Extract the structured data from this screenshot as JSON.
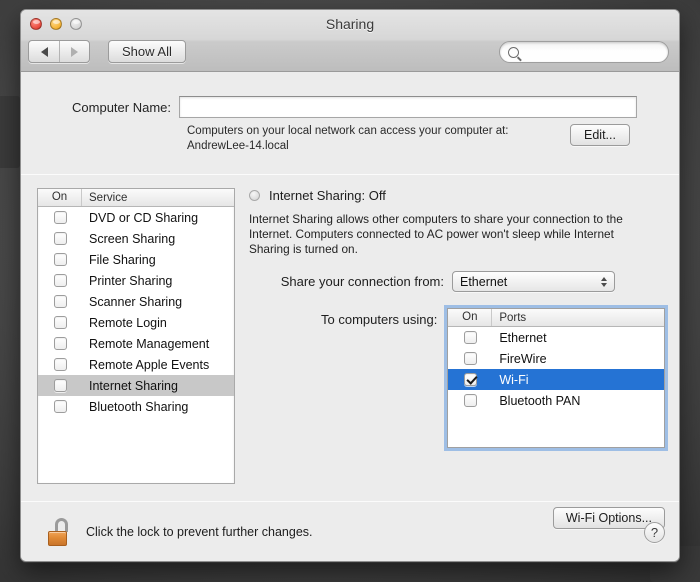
{
  "window": {
    "title": "Sharing",
    "traffic_lights": [
      "close-button",
      "minimize-button",
      "zoom-button"
    ]
  },
  "toolbar": {
    "back_label": "◀",
    "forward_label": "▶",
    "show_all_label": "Show All",
    "search_value": "",
    "search_placeholder": ""
  },
  "computer_name": {
    "label": "Computer Name:",
    "value": "",
    "placeholder": "",
    "help_line1": "Computers on your local network can access your computer at:",
    "help_line2": "AndrewLee-14.local",
    "edit_label": "Edit..."
  },
  "services_list": {
    "header_on": "On",
    "header_service": "Service",
    "rows": [
      {
        "label": "DVD or CD Sharing",
        "checked": false,
        "selected": false
      },
      {
        "label": "Screen Sharing",
        "checked": false,
        "selected": false
      },
      {
        "label": "File Sharing",
        "checked": false,
        "selected": false
      },
      {
        "label": "Printer Sharing",
        "checked": false,
        "selected": false
      },
      {
        "label": "Scanner Sharing",
        "checked": false,
        "selected": false
      },
      {
        "label": "Remote Login",
        "checked": false,
        "selected": false
      },
      {
        "label": "Remote Management",
        "checked": false,
        "selected": false
      },
      {
        "label": "Remote Apple Events",
        "checked": false,
        "selected": false
      },
      {
        "label": "Internet Sharing",
        "checked": false,
        "selected": true
      },
      {
        "label": "Bluetooth Sharing",
        "checked": false,
        "selected": false
      }
    ]
  },
  "detail": {
    "status_title": "Internet Sharing: Off",
    "status_state": "Off",
    "description": "Internet Sharing allows other computers to share your connection to the Internet. Computers connected to AC power won't sleep while Internet Sharing is turned on.",
    "share_from_label": "Share your connection from:",
    "share_from_value": "Ethernet",
    "share_from_options": [
      "Ethernet"
    ],
    "to_computers_label": "To computers using:",
    "ports_header_on": "On",
    "ports_header_ports": "Ports",
    "ports": [
      {
        "label": "Ethernet",
        "checked": false,
        "selected": false
      },
      {
        "label": "FireWire",
        "checked": false,
        "selected": false
      },
      {
        "label": "Wi-Fi",
        "checked": true,
        "selected": true
      },
      {
        "label": "Bluetooth PAN",
        "checked": false,
        "selected": false
      }
    ],
    "wifi_options_label": "Wi-Fi Options..."
  },
  "footer": {
    "lock_text": "Click the lock to prevent further changes.",
    "help_label": "?"
  },
  "colors": {
    "selection_blue": "#2573d4",
    "selection_gray": "#c8c8c8",
    "window_bg": "#ececec",
    "lock_orange": "#e08a36"
  }
}
